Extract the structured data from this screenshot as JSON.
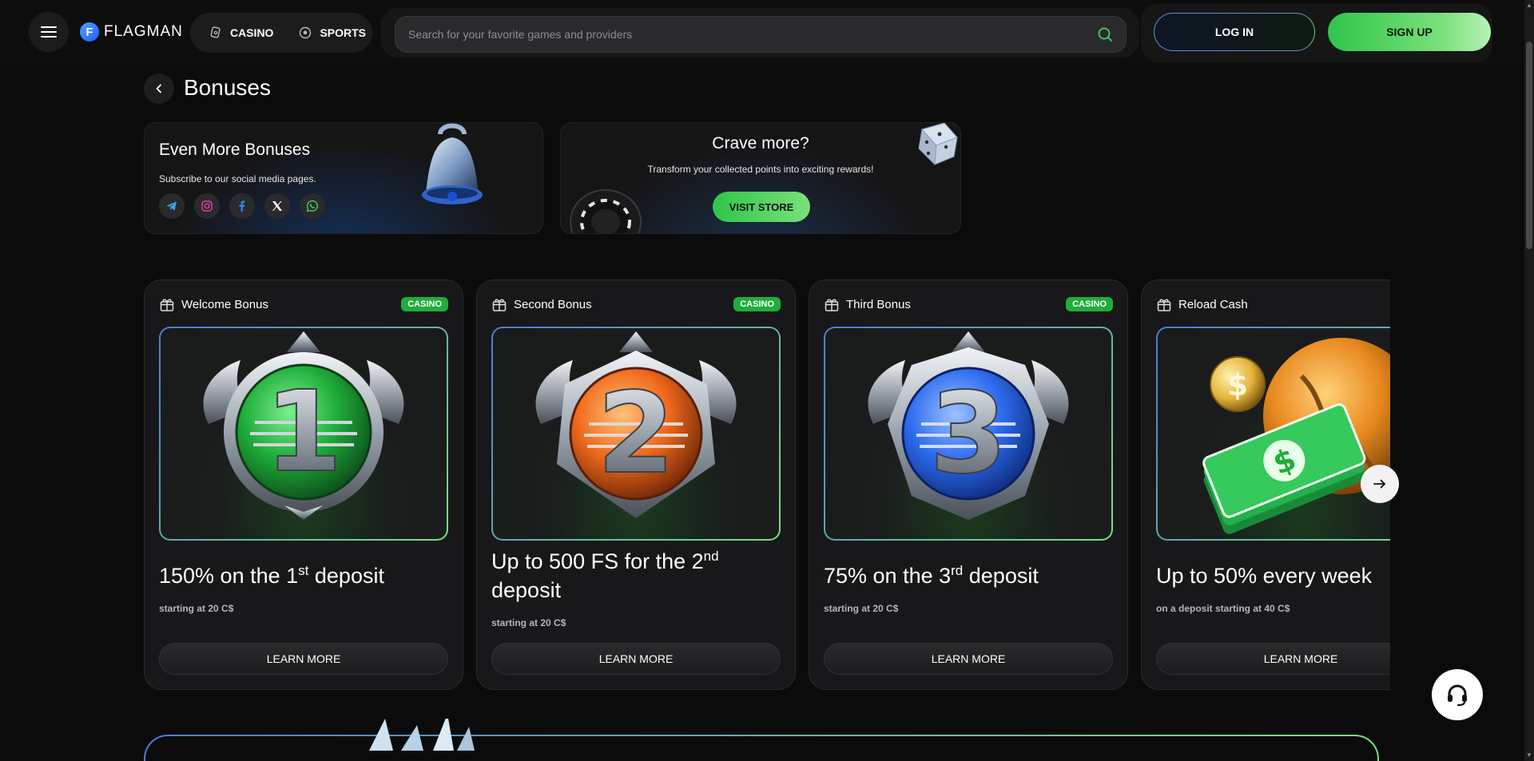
{
  "header": {
    "logo_text": "FLAGMAN",
    "logo_mark": "F",
    "nav": [
      {
        "label": "CASINO",
        "icon": "casino-icon"
      },
      {
        "label": "SPORTS",
        "icon": "soccer-ball-icon"
      }
    ],
    "search_placeholder": "Search for your favorite games and providers",
    "login_label": "LOG IN",
    "signup_label": "SIGN UP"
  },
  "page": {
    "title": "Bonuses"
  },
  "promos": {
    "social": {
      "title": "Even More Bonuses",
      "subtitle": "Subscribe to our social media pages.",
      "icons": [
        "telegram-icon",
        "instagram-icon",
        "facebook-icon",
        "x-icon",
        "whatsapp-icon"
      ]
    },
    "store": {
      "title": "Crave more?",
      "subtitle": "Transform your collected points into exciting rewards!",
      "button": "VISIT STORE"
    }
  },
  "bonuses": [
    {
      "label": "Welcome Bonus",
      "badge": "CASINO",
      "number": "1",
      "title_pre": "150% on the 1",
      "title_sup": "st",
      "title_post": " deposit",
      "subtitle": "starting at 20 C$",
      "button": "LEARN MORE",
      "medal_color": "#22c24a"
    },
    {
      "label": "Second Bonus",
      "badge": "CASINO",
      "number": "2",
      "title_pre": "Up to 500 FS for the 2",
      "title_sup": "nd",
      "title_post": " deposit",
      "subtitle": "starting at 20 C$",
      "button": "LEARN MORE",
      "medal_color": "#f06a1c"
    },
    {
      "label": "Third Bonus",
      "badge": "CASINO",
      "number": "3",
      "title_pre": "75% on the 3",
      "title_sup": "rd",
      "title_post": " deposit",
      "subtitle": "starting at 20 C$",
      "button": "LEARN MORE",
      "medal_color": "#2f6df0"
    },
    {
      "label": "Reload Cash",
      "badge": "",
      "number": "$",
      "title_pre": "Up to 50% every week",
      "title_sup": "",
      "title_post": "",
      "subtitle": "on a deposit starting at 40 C$",
      "button": "LEARN MORE",
      "medal_color": "#e8891e"
    }
  ],
  "colors": {
    "accent_green": "#2fc54a",
    "accent_blue": "#4a7dd6",
    "background": "#0b0b0c"
  }
}
